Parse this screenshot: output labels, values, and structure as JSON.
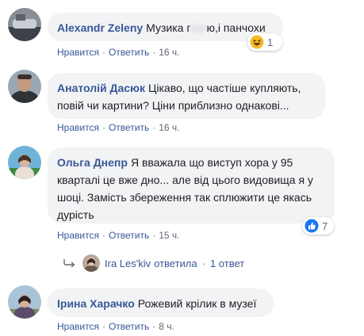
{
  "comments": [
    {
      "author": "Alexandr Zeleny",
      "text_before": "Музика г",
      "text_after": "ю,і панчохи",
      "actions": {
        "like": "Нравится",
        "reply": "Ответить",
        "time": "16 ч."
      },
      "reaction": {
        "icon": "haha-emoji-icon",
        "count": "1",
        "color": "#f7b928"
      }
    },
    {
      "author": "Анатолій Дасюк",
      "text": "Цікаво, що частіше купляють, повій чи картини? Ціни приблизно однакові...",
      "actions": {
        "like": "Нравится",
        "reply": "Ответить",
        "time": "16 ч."
      }
    },
    {
      "author": "Ольга Днепр",
      "text": "Я вважала що виступ хора у 95 кварталі це вже дно... але від цього видовища я у шоці. Замість збереження так сплюжити це якась дурість",
      "actions": {
        "like": "Нравится",
        "reply": "Ответить",
        "time": "15 ч."
      },
      "reaction": {
        "icon": "like-thumb-icon",
        "count": "7",
        "color": "#1877f2"
      },
      "replies": {
        "name": "Ira Les'kiv",
        "verb": "ответила",
        "count": "1 ответ"
      }
    },
    {
      "author": "Ірина Харачко",
      "text": "Рожевий крілик в музеї",
      "actions": {
        "like": "Нравится",
        "reply": "Ответить",
        "time": "8 ч."
      }
    }
  ]
}
